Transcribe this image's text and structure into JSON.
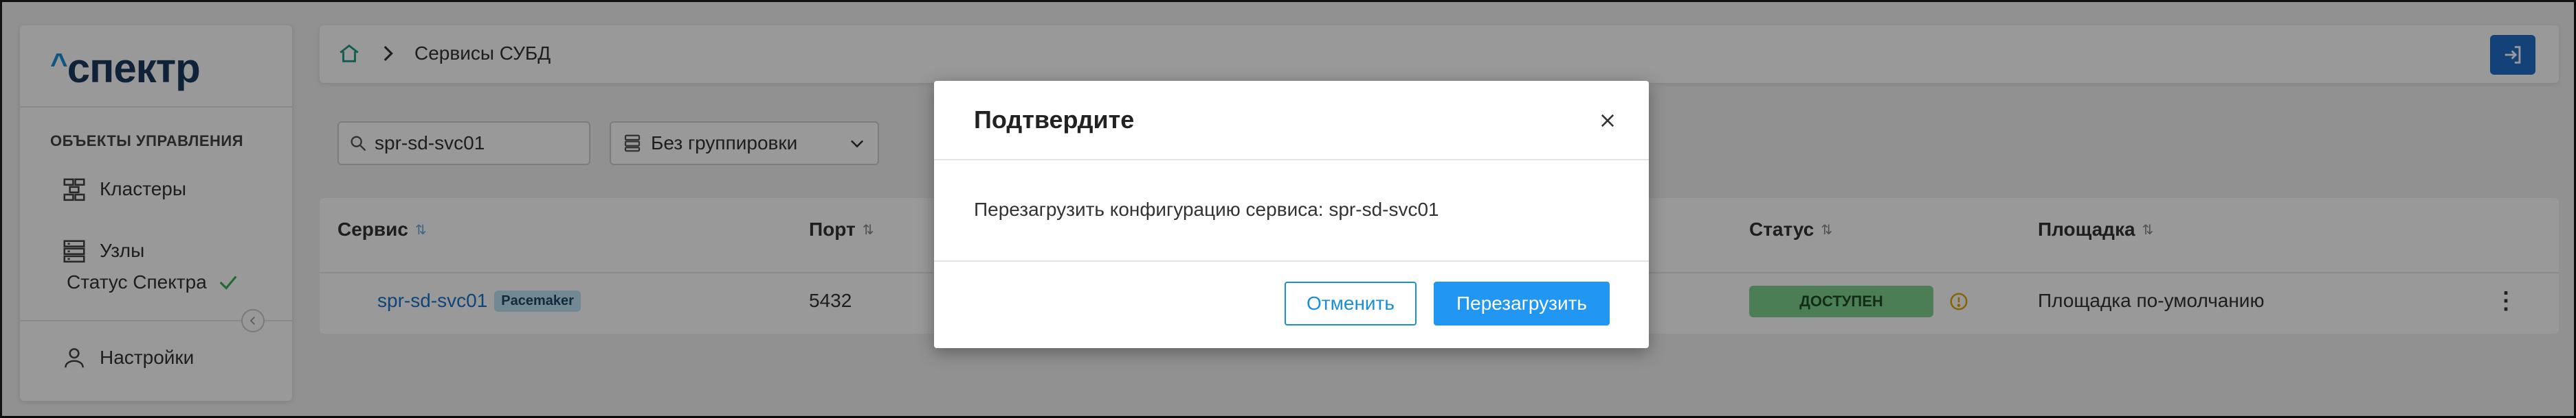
{
  "app": {
    "logo_caret": "^",
    "logo_text": "спектр"
  },
  "sidebar": {
    "section_title": "ОБЪЕКТЫ УПРАВЛЕНИЯ",
    "items": [
      {
        "label": "Кластеры",
        "icon": "clusters-icon"
      },
      {
        "label": "Узлы",
        "icon": "nodes-icon"
      }
    ],
    "status_label": "Статус Спектра",
    "settings_label": "Настройки"
  },
  "header": {
    "breadcrumb": {
      "current": "Сервисы СУБД"
    }
  },
  "filters": {
    "search_value": "spr-sd-svc01",
    "grouping_value": "Без группировки"
  },
  "table": {
    "columns": {
      "service": "Сервис",
      "port": "Порт",
      "status": "Статус",
      "site": "Площадка"
    },
    "rows": [
      {
        "service": "spr-sd-svc01",
        "tag": "Pacemaker",
        "port": "5432",
        "status": "ДОСТУПЕН",
        "site": "Площадка по-умолчанию"
      }
    ]
  },
  "modal": {
    "title": "Подтвердите",
    "message": "Перезагрузить конфигурацию сервиса: spr-sd-svc01",
    "cancel_label": "Отменить",
    "confirm_label": "Перезагрузить"
  },
  "colors": {
    "accent": "#2196f3",
    "link": "#1a73c8",
    "status_ok": "#7fd38f",
    "warning": "#e0a800",
    "overlay": "rgba(0,0,0,0.40)"
  }
}
